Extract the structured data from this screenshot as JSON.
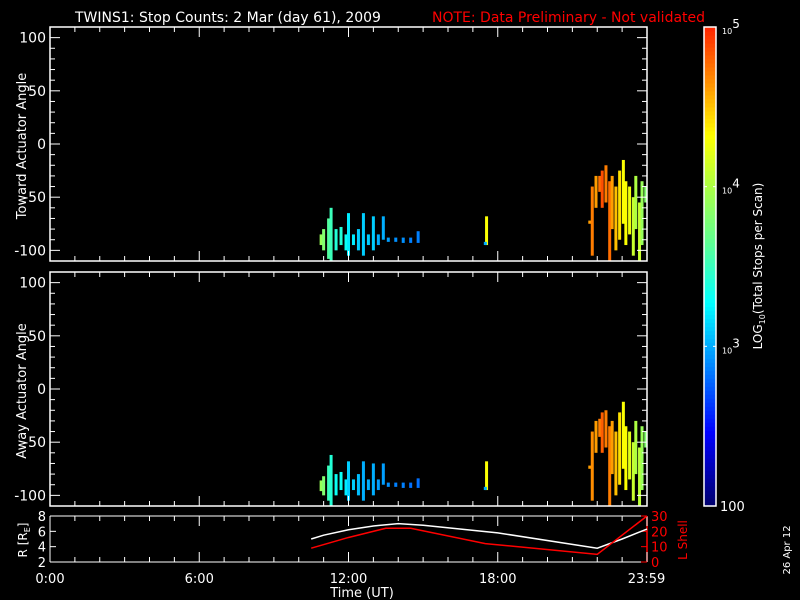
{
  "title": {
    "main": "TWINS1: Stop Counts:  2 Mar (day  61), 2009",
    "note": "NOTE: Data Preliminary - Not validated"
  },
  "colors": {
    "axis": "#ffffff",
    "note": "#ff0000",
    "lshell": "#ff0000",
    "radius": "#ffffff"
  },
  "date_stamp": "26 Apr 12",
  "chart_data": [
    {
      "type": "heatmap",
      "name": "toward",
      "ylabel": "Toward Actuator Angle",
      "ylim": [
        -110,
        110
      ],
      "yticks": [
        100,
        50,
        0,
        -50,
        -100
      ],
      "xlim": [
        0,
        24
      ],
      "segments_format": [
        "time_hr",
        "angle_min",
        "angle_max",
        "log10_counts"
      ],
      "segments": [
        [
          10.9,
          -95,
          -85,
          3.9
        ],
        [
          11.0,
          -100,
          -80,
          3.8
        ],
        [
          11.2,
          -108,
          -70,
          3.6
        ],
        [
          11.3,
          -110,
          -60,
          3.5
        ],
        [
          11.5,
          -100,
          -80,
          3.4
        ],
        [
          11.7,
          -95,
          -78,
          3.4
        ],
        [
          11.9,
          -100,
          -85,
          3.3
        ],
        [
          12.0,
          -105,
          -65,
          3.2
        ],
        [
          12.2,
          -95,
          -85,
          3.2
        ],
        [
          12.4,
          -100,
          -80,
          3.1
        ],
        [
          12.6,
          -105,
          -65,
          3.1
        ],
        [
          12.8,
          -95,
          -85,
          3.1
        ],
        [
          13.0,
          -100,
          -68,
          3.1
        ],
        [
          13.2,
          -95,
          -85,
          3.0
        ],
        [
          13.4,
          -90,
          -68,
          3.0
        ],
        [
          13.6,
          -92,
          -88,
          2.95
        ],
        [
          13.9,
          -92,
          -88,
          2.9
        ],
        [
          14.2,
          -93,
          -88,
          2.9
        ],
        [
          14.5,
          -93,
          -88,
          2.85
        ],
        [
          14.8,
          -93,
          -82,
          2.85
        ],
        [
          17.55,
          -95,
          -68,
          4.3
        ],
        [
          17.5,
          -95,
          -92,
          3.0
        ],
        [
          21.7,
          -75,
          -72,
          4.6
        ],
        [
          21.8,
          -105,
          -40,
          4.7
        ],
        [
          21.95,
          -60,
          -30,
          4.6
        ],
        [
          22.1,
          -45,
          -30,
          4.75
        ],
        [
          22.2,
          -60,
          -25,
          4.85
        ],
        [
          22.35,
          -55,
          -20,
          4.7
        ],
        [
          22.5,
          -110,
          -35,
          4.75
        ],
        [
          22.6,
          -80,
          -30,
          4.6
        ],
        [
          22.75,
          -100,
          -40,
          4.5
        ],
        [
          22.9,
          -90,
          -25,
          4.4
        ],
        [
          23.05,
          -75,
          -15,
          4.3
        ],
        [
          23.15,
          -95,
          -35,
          4.3
        ],
        [
          23.3,
          -85,
          -40,
          4.25
        ],
        [
          23.45,
          -105,
          -50,
          4.1
        ],
        [
          23.55,
          -80,
          -30,
          4.0
        ],
        [
          23.7,
          -110,
          -55,
          4.1
        ],
        [
          23.8,
          -95,
          -35,
          3.9
        ],
        [
          23.95,
          -55,
          -40,
          3.8
        ]
      ]
    },
    {
      "type": "heatmap",
      "name": "away",
      "ylabel": "Away Actuator Angle",
      "ylim": [
        -110,
        110
      ],
      "yticks": [
        100,
        50,
        0,
        -50,
        -100
      ],
      "xlim": [
        0,
        24
      ],
      "segments_format": [
        "time_hr",
        "angle_min",
        "angle_max",
        "log10_counts"
      ],
      "segments": [
        [
          10.9,
          -96,
          -86,
          3.9
        ],
        [
          11.0,
          -100,
          -82,
          3.8
        ],
        [
          11.2,
          -105,
          -72,
          3.5
        ],
        [
          11.3,
          -110,
          -62,
          3.4
        ],
        [
          11.5,
          -100,
          -80,
          3.3
        ],
        [
          11.7,
          -95,
          -78,
          3.3
        ],
        [
          11.9,
          -100,
          -85,
          3.2
        ],
        [
          12.0,
          -105,
          -68,
          3.1
        ],
        [
          12.2,
          -95,
          -85,
          3.1
        ],
        [
          12.4,
          -100,
          -80,
          3.05
        ],
        [
          12.6,
          -105,
          -68,
          3.0
        ],
        [
          12.8,
          -95,
          -85,
          3.0
        ],
        [
          13.0,
          -100,
          -70,
          3.0
        ],
        [
          13.2,
          -95,
          -85,
          2.95
        ],
        [
          13.4,
          -90,
          -70,
          2.95
        ],
        [
          13.6,
          -92,
          -88,
          2.9
        ],
        [
          13.9,
          -92,
          -88,
          2.85
        ],
        [
          14.2,
          -93,
          -88,
          2.85
        ],
        [
          14.5,
          -93,
          -88,
          2.8
        ],
        [
          14.8,
          -93,
          -84,
          2.8
        ],
        [
          17.55,
          -95,
          -68,
          4.3
        ],
        [
          17.5,
          -95,
          -92,
          3.0
        ],
        [
          21.7,
          -75,
          -72,
          4.6
        ],
        [
          21.8,
          -105,
          -40,
          4.65
        ],
        [
          21.95,
          -60,
          -30,
          4.6
        ],
        [
          22.1,
          -45,
          -28,
          4.7
        ],
        [
          22.2,
          -60,
          -22,
          4.8
        ],
        [
          22.35,
          -55,
          -20,
          4.7
        ],
        [
          22.5,
          -110,
          -35,
          4.7
        ],
        [
          22.6,
          -80,
          -30,
          4.6
        ],
        [
          22.75,
          -100,
          -40,
          4.5
        ],
        [
          22.9,
          -90,
          -22,
          4.4
        ],
        [
          23.05,
          -75,
          -12,
          4.3
        ],
        [
          23.15,
          -95,
          -35,
          4.3
        ],
        [
          23.3,
          -85,
          -40,
          4.2
        ],
        [
          23.45,
          -105,
          -50,
          4.1
        ],
        [
          23.55,
          -80,
          -30,
          4.0
        ],
        [
          23.7,
          -110,
          -55,
          4.05
        ],
        [
          23.8,
          -95,
          -35,
          3.9
        ],
        [
          23.95,
          -55,
          -40,
          3.8
        ]
      ]
    },
    {
      "type": "line",
      "name": "orbit",
      "xlabel": "Time (UT)",
      "xticks": [
        "0:00",
        "6:00",
        "12:00",
        "18:00",
        "23:59"
      ],
      "xtick_values": [
        0,
        6,
        12,
        18,
        23.98
      ],
      "xlim": [
        0,
        24
      ],
      "ylabel_left": "R [R",
      "ylabel_left_sub": "E",
      "ylabel_left_end": "]",
      "ylim_left": [
        2,
        8
      ],
      "yticks_left": [
        2,
        4,
        6,
        8
      ],
      "ylabel_right": "L Shell",
      "ylim_right": [
        0,
        30
      ],
      "yticks_right": [
        0,
        10,
        20,
        30
      ],
      "series": [
        {
          "name": "R",
          "axis": "left",
          "x": [
            10.5,
            11,
            12,
            13,
            14,
            15,
            18,
            22,
            23,
            24
          ],
          "y": [
            5.0,
            5.5,
            6.2,
            6.7,
            7.0,
            6.8,
            5.8,
            3.8,
            5.0,
            6.3
          ]
        },
        {
          "name": "L Shell",
          "axis": "right",
          "x": [
            10.5,
            12,
            13.5,
            14.5,
            17.5,
            22,
            24
          ],
          "y": [
            9,
            16,
            22,
            22,
            12,
            5,
            30
          ]
        }
      ]
    },
    {
      "type": "colorbar",
      "name": "colorbar",
      "label": "LOG",
      "label_sub": "10",
      "label_end": "(Total Stops per Scan)",
      "range_log10": [
        2,
        5
      ],
      "ticks": [
        {
          "log": 5,
          "base": "10",
          "exp": "5"
        },
        {
          "log": 4,
          "base": "10",
          "exp": "4"
        },
        {
          "log": 3,
          "base": "10",
          "exp": "3"
        },
        {
          "log": 2,
          "base": "100",
          "exp": ""
        }
      ]
    }
  ]
}
